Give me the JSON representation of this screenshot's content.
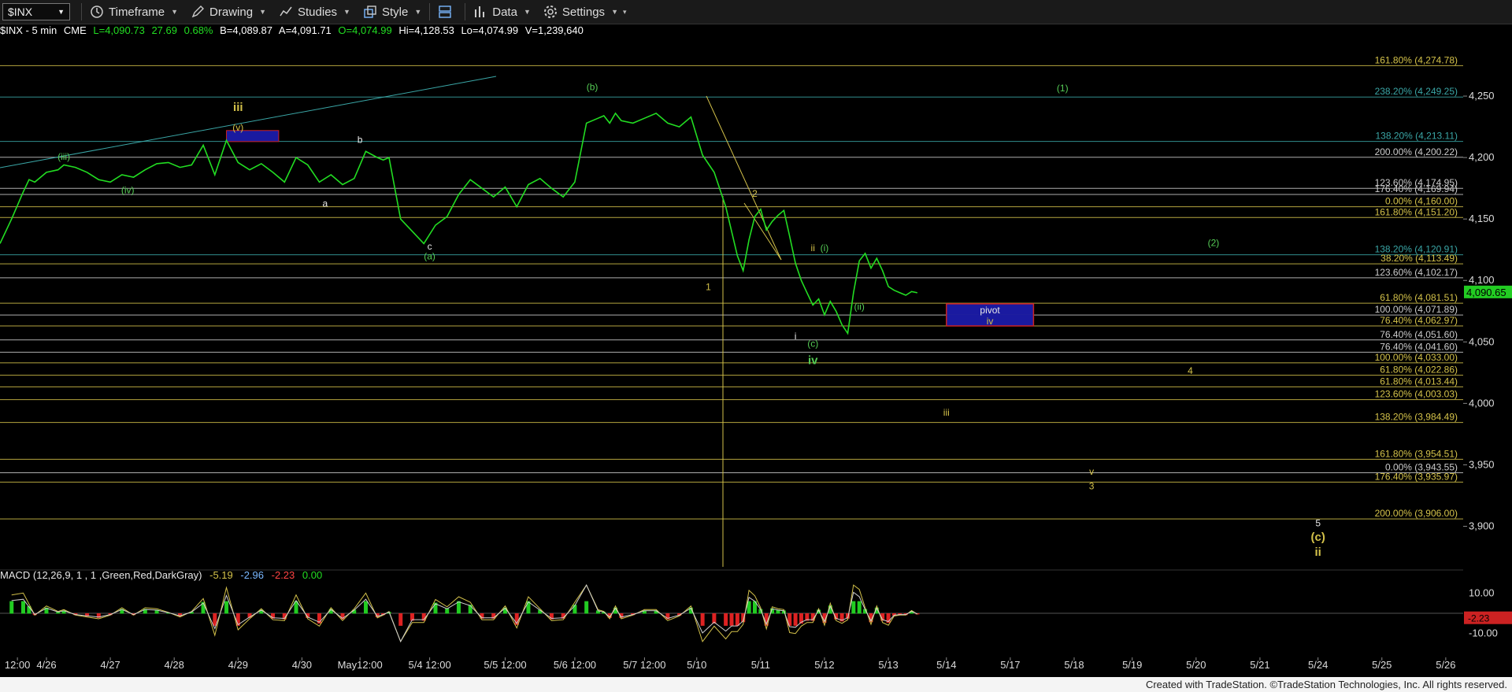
{
  "toolbar": {
    "symbol": "$INX",
    "buttons": [
      {
        "label": "Timeframe",
        "icon": "clock-icon"
      },
      {
        "label": "Drawing",
        "icon": "pencil-icon"
      },
      {
        "label": "Studies",
        "icon": "studies-icon"
      },
      {
        "label": "Style",
        "icon": "style-icon"
      },
      {
        "label": "Data",
        "icon": "data-icon"
      },
      {
        "label": "Settings",
        "icon": "gear-icon"
      }
    ]
  },
  "info": {
    "symbol": "$INX - 5 min",
    "exchange": "CME",
    "last": "L=4,090.73",
    "change": "27.69",
    "pct": "0.68%",
    "bid": "B=4,089.87",
    "ask": "A=4,091.71",
    "open": "O=4,074.99",
    "high": "Hi=4,128.53",
    "low": "Lo=4,074.99",
    "volume": "V=1,239,640"
  },
  "macd": {
    "label": "MACD (12,26,9, 1 , 1 ,Green,Red,DarkGray)",
    "v1": "-5.19",
    "v2": "-2.96",
    "v3": "-2.23",
    "v4": "0.00",
    "ticks": [
      {
        "v": 10,
        "label": "10.00"
      },
      {
        "v": -10,
        "label": "-10.00"
      }
    ],
    "ylim": [
      -16,
      16
    ],
    "current_label": "-2.23"
  },
  "footer": "Created with TradeStation. ©TradeStation Technologies, Inc. All rights reserved.",
  "colors": {
    "price": "#22dd22",
    "gold": "#d4c24a",
    "green_label": "#55cc55",
    "white_label": "#e8e8e8",
    "teal": "#3aa6a6",
    "blue_box": "#1a1aa0",
    "red_border": "#cc2222"
  },
  "chart_data": {
    "type": "line",
    "ylim": [
      3867,
      4300
    ],
    "price_ticks": [
      {
        "v": 4250,
        "label": "4,250"
      },
      {
        "v": 4200,
        "label": "4,200"
      },
      {
        "v": 4150,
        "label": "4,150"
      },
      {
        "v": 4100,
        "label": "4,100"
      },
      {
        "v": 4050,
        "label": "4,050"
      },
      {
        "v": 4000,
        "label": "4,000"
      },
      {
        "v": 3950,
        "label": "3,950"
      },
      {
        "v": 3900,
        "label": "3,900"
      }
    ],
    "current_price": {
      "v": 4090.65,
      "label": "4,090.65"
    },
    "x_ticks": [
      {
        "label": "12:00",
        "i": 3
      },
      {
        "label": "4/26",
        "i": 8
      },
      {
        "label": "4/27",
        "i": 19
      },
      {
        "label": "4/28",
        "i": 30
      },
      {
        "label": "4/29",
        "i": 41
      },
      {
        "label": "4/30",
        "i": 52
      },
      {
        "label": "May12:00",
        "i": 62
      },
      {
        "label": "5/4 12:00",
        "i": 74
      },
      {
        "label": "5/5 12:00",
        "i": 87
      },
      {
        "label": "5/6 12:00",
        "i": 99
      },
      {
        "label": "5/7 12:00",
        "i": 111
      },
      {
        "label": "5/10",
        "i": 120
      },
      {
        "label": "5/11",
        "i": 131
      },
      {
        "label": "5/12",
        "i": 142
      },
      {
        "label": "5/13",
        "i": 153
      },
      {
        "label": "5/14",
        "i": 163
      },
      {
        "label": "5/17",
        "i": 174
      },
      {
        "label": "5/18",
        "i": 185
      },
      {
        "label": "5/19",
        "i": 195
      },
      {
        "label": "5/20",
        "i": 206
      },
      {
        "label": "5/21",
        "i": 217
      },
      {
        "label": "5/24",
        "i": 227
      },
      {
        "label": "5/25",
        "i": 238
      },
      {
        "label": "5/26",
        "i": 249
      }
    ],
    "series": [
      {
        "i": [
          0,
          2,
          4,
          5,
          6,
          8,
          10,
          11,
          13,
          15,
          17,
          19,
          21,
          23,
          25,
          27,
          29,
          31,
          33,
          35,
          37,
          39,
          41,
          43,
          45,
          47,
          49,
          51,
          53,
          55,
          57,
          59,
          61,
          63,
          65,
          66,
          67,
          69,
          71,
          73,
          75,
          77,
          79,
          81,
          83,
          85,
          87,
          89,
          91,
          93,
          95,
          97,
          99,
          101,
          103,
          104,
          105,
          106,
          107,
          109,
          111,
          113,
          115,
          117,
          119,
          121,
          123,
          125,
          126,
          127,
          128,
          129,
          130,
          131,
          132,
          133,
          134,
          135,
          136,
          137,
          138,
          139,
          140,
          141,
          142,
          143,
          144,
          145,
          146,
          147,
          148,
          149,
          150,
          151,
          152,
          153,
          154,
          155,
          156,
          157,
          158,
          159,
          160
        ],
        "values": [
          4130,
          4150,
          4172,
          4182,
          4180,
          4188,
          4190,
          4194,
          4192,
          4188,
          4182,
          4180,
          4186,
          4184,
          4190,
          4195,
          4196,
          4192,
          4194,
          4210,
          4186,
          4214,
          4196,
          4190,
          4195,
          4188,
          4180,
          4200,
          4194,
          4180,
          4186,
          4178,
          4183,
          4205,
          4200,
          4198,
          4200,
          4150,
          4140,
          4130,
          4145,
          4152,
          4170,
          4182,
          4175,
          4168,
          4176,
          4160,
          4178,
          4183,
          4175,
          4168,
          4180,
          4228,
          4232,
          4234,
          4228,
          4236,
          4230,
          4228,
          4232,
          4236,
          4228,
          4225,
          4233,
          4202,
          4188,
          4160,
          4140,
          4120,
          4108,
          4133,
          4152,
          4158,
          4141,
          4148,
          4153,
          4157,
          4136,
          4114,
          4100,
          4090,
          4080,
          4085,
          4072,
          4083,
          4075,
          4064,
          4057,
          4090,
          4116,
          4122,
          4110,
          4118,
          4108,
          4095,
          4092,
          4090,
          4088,
          4091,
          4090
        ]
      }
    ],
    "fib_levels": [
      {
        "v": 4274.78,
        "label": "161.80% (4,274.78)",
        "color": "#d4c24a"
      },
      {
        "v": 4249.25,
        "label": "238.20% (4,249.25)",
        "color": "#3aa6a6"
      },
      {
        "v": 4213.11,
        "label": "138.20% (4,213.11)",
        "color": "#3aa6a6"
      },
      {
        "v": 4200.22,
        "label": "200.00% (4,200.22)",
        "color": "#cccccc"
      },
      {
        "v": 4174.95,
        "label": "123.60% (4,174.95)",
        "color": "#cccccc"
      },
      {
        "v": 4169.94,
        "label": "176.40% (4,169.94)",
        "color": "#cccccc"
      },
      {
        "v": 4160.0,
        "label": "0.00% (4,160.00)",
        "color": "#d4c24a"
      },
      {
        "v": 4151.2,
        "label": "161.80% (4,151.20)",
        "color": "#d4c24a"
      },
      {
        "v": 4120.91,
        "label": "138.20% (4,120.91)",
        "color": "#3aa6a6"
      },
      {
        "v": 4113.49,
        "label": "38.20% (4,113.49)",
        "color": "#d4c24a"
      },
      {
        "v": 4102.17,
        "label": "123.60% (4,102.17)",
        "color": "#cccccc"
      },
      {
        "v": 4081.51,
        "label": "61.80% (4,081.51)",
        "color": "#d4c24a"
      },
      {
        "v": 4071.89,
        "label": "100.00% (4,071.89)",
        "color": "#cccccc"
      },
      {
        "v": 4062.97,
        "label": "76.40% (4,062.97)",
        "color": "#d4c24a"
      },
      {
        "v": 4051.6,
        "label": "76.40% (4,051.60)",
        "color": "#cccccc"
      },
      {
        "v": 4041.6,
        "label": "76.40% (4,041.60)",
        "color": "#cccccc"
      },
      {
        "v": 4033.0,
        "label": "100.00% (4,033.00)",
        "color": "#d4c24a"
      },
      {
        "v": 4022.86,
        "label": "61.80% (4,022.86)",
        "color": "#d4c24a"
      },
      {
        "v": 4013.44,
        "label": "61.80% (4,013.44)",
        "color": "#d4c24a"
      },
      {
        "v": 4003.03,
        "label": "123.60% (4,003.03)",
        "color": "#d4c24a"
      },
      {
        "v": 3984.49,
        "label": "138.20% (3,984.49)",
        "color": "#d4c24a"
      },
      {
        "v": 3954.51,
        "label": "161.80% (3,954.51)",
        "color": "#d4c24a"
      },
      {
        "v": 3943.55,
        "label": "0.00% (3,943.55)",
        "color": "#cccccc"
      },
      {
        "v": 3935.97,
        "label": "176.40% (3,935.97)",
        "color": "#d4c24a"
      },
      {
        "v": 3906.0,
        "label": "200.00% (3,906.00)",
        "color": "#d4c24a"
      }
    ],
    "annotations": [
      {
        "text": "iii",
        "i": 41,
        "v": 4238,
        "color": "#d4c24a",
        "bold": true
      },
      {
        "text": "(v)",
        "i": 41,
        "v": 4222,
        "color": "#d4c24a"
      },
      {
        "text": "(iii)",
        "i": 11,
        "v": 4198,
        "color": "#55cc55"
      },
      {
        "text": "(iv)",
        "i": 22,
        "v": 4171,
        "color": "#55cc55"
      },
      {
        "text": "b",
        "i": 62,
        "v": 4212,
        "color": "#e8e8e8"
      },
      {
        "text": "a",
        "i": 56,
        "v": 4160,
        "color": "#e8e8e8"
      },
      {
        "text": "c",
        "i": 74,
        "v": 4125,
        "color": "#e8e8e8"
      },
      {
        "text": "(a)",
        "i": 74,
        "v": 4117,
        "color": "#55cc55"
      },
      {
        "text": "(b)",
        "i": 102,
        "v": 4255,
        "color": "#55cc55"
      },
      {
        "text": "1",
        "i": 122,
        "v": 4092,
        "color": "#d4c24a"
      },
      {
        "text": "2",
        "i": 130,
        "v": 4168,
        "color": "#d4c24a"
      },
      {
        "text": "ii",
        "i": 140,
        "v": 4124,
        "color": "#d4c24a"
      },
      {
        "text": "(i)",
        "i": 142,
        "v": 4124,
        "color": "#55cc55"
      },
      {
        "text": "(ii)",
        "i": 148,
        "v": 4076,
        "color": "#55cc55"
      },
      {
        "text": "i",
        "i": 137,
        "v": 4052,
        "color": "#e8e8e8"
      },
      {
        "text": "(c)",
        "i": 140,
        "v": 4046,
        "color": "#55cc55"
      },
      {
        "text": "iv",
        "i": 140,
        "v": 4032,
        "color": "#55cc55",
        "bold": true
      },
      {
        "text": "(1)",
        "i": 183,
        "v": 4254,
        "color": "#55cc55"
      },
      {
        "text": "(2)",
        "i": 209,
        "v": 4128,
        "color": "#55cc55"
      },
      {
        "text": "4",
        "i": 205,
        "v": 4024,
        "color": "#d4c24a"
      },
      {
        "text": "iii",
        "i": 163,
        "v": 3990,
        "color": "#d4c24a"
      },
      {
        "text": "v",
        "i": 188,
        "v": 3942,
        "color": "#d4c24a"
      },
      {
        "text": "3",
        "i": 188,
        "v": 3930,
        "color": "#d4c24a"
      },
      {
        "text": "5",
        "i": 227,
        "v": 3900,
        "color": "#e8e8e8"
      },
      {
        "text": "(c)",
        "i": 227,
        "v": 3888,
        "color": "#d4c24a",
        "bold": true
      },
      {
        "text": "ii",
        "i": 227,
        "v": 3876,
        "color": "#d4c24a",
        "bold": true
      }
    ],
    "pivot_box": {
      "i0": 163,
      "i1": 178,
      "v0": 4063,
      "v1": 4081,
      "top_label": "pivot",
      "bottom_label": "iv"
    },
    "small_box": {
      "i0": 39,
      "i1": 48,
      "v0": 4213,
      "v1": 4222
    }
  }
}
